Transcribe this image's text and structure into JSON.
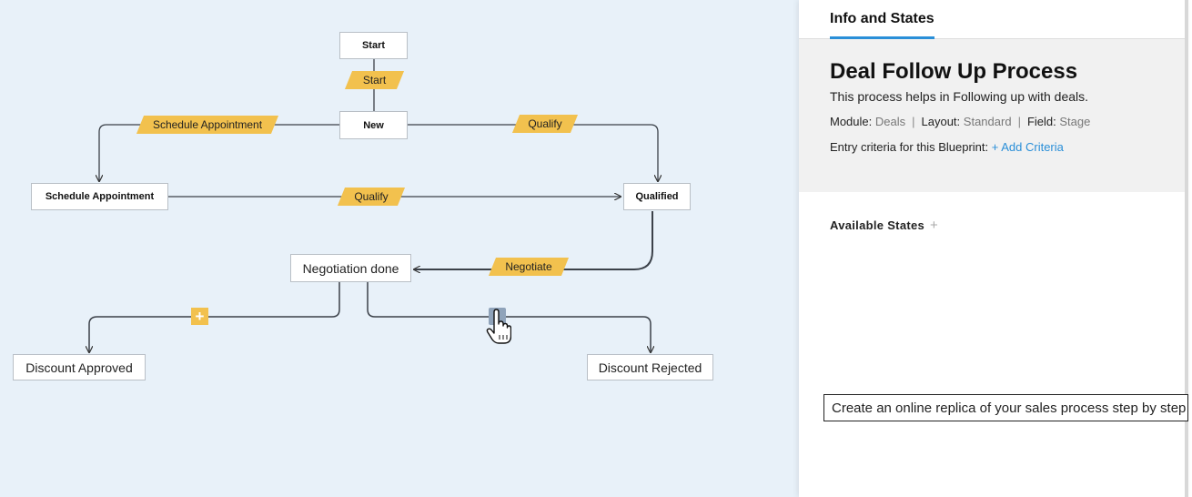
{
  "canvas": {
    "nodes": {
      "start": "Start",
      "new": "New",
      "schedule": "Schedule Appointment",
      "qualified": "Qualified",
      "negotiation": "Negotiation done",
      "approved": "Discount Approved",
      "rejected": "Discount Rejected"
    },
    "transitions": {
      "start": "Start",
      "schedule": "Schedule Appointment",
      "qualify_top": "Qualify",
      "qualify_mid": "Qualify",
      "negotiate": "Negotiate"
    },
    "add_button": "+",
    "icons": {
      "add": "plus-icon",
      "cursor": "hand-pointer-icon"
    }
  },
  "panel": {
    "tab": "Info and States",
    "title": "Deal Follow Up Process",
    "description": "This process helps in Following up with deals.",
    "module_label": "Module:",
    "module_value": "Deals",
    "layout_label": "Layout:",
    "layout_value": "Standard",
    "field_label": "Field:",
    "field_value": "Stage",
    "separator": "|",
    "entry_label": "Entry criteria for this Blueprint:",
    "entry_link": "+ Add Criteria",
    "states_label": "Available States",
    "states_add": "+"
  },
  "caption": "Create an online replica of your sales process step by step",
  "colors": {
    "canvas_bg": "#e8f1f9",
    "transition": "#f2c14e",
    "accent": "#2a8fd8"
  }
}
